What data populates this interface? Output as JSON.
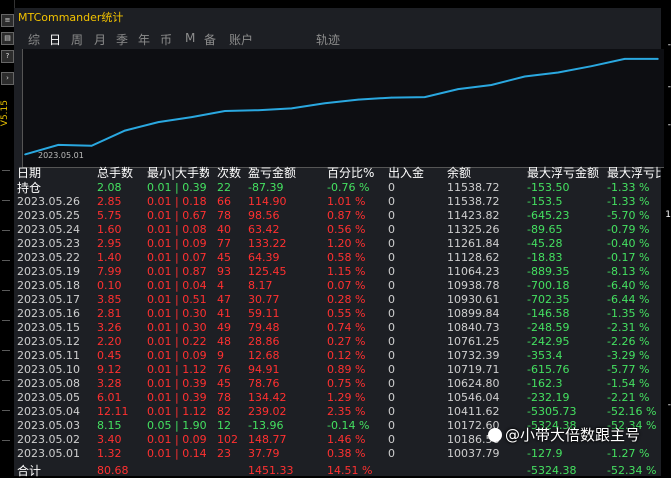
{
  "window": {
    "title": "MTCommander统计"
  },
  "sidebar": {
    "version": "V5.15"
  },
  "tabs": [
    {
      "label": "综",
      "active": false
    },
    {
      "label": "日",
      "active": true
    },
    {
      "label": "周",
      "active": false
    },
    {
      "label": "月",
      "active": false
    },
    {
      "label": "季",
      "active": false
    },
    {
      "label": "年",
      "active": false
    },
    {
      "label": "币",
      "active": false
    },
    {
      "label": "M",
      "active": false
    },
    {
      "label": "备",
      "active": false
    },
    {
      "label": "账户",
      "active": false
    },
    {
      "label": "轨迹",
      "active": false
    }
  ],
  "chart": {
    "x_label": "2023.05.01",
    "line_color": "#2aa8e0"
  },
  "chart_data": {
    "type": "line",
    "x": [
      "2023.05.01",
      "2023.05.02",
      "2023.05.03",
      "2023.05.04",
      "2023.05.05",
      "2023.05.08",
      "2023.05.09",
      "2023.05.10",
      "2023.05.11",
      "2023.05.12",
      "2023.05.15",
      "2023.05.16",
      "2023.05.17",
      "2023.05.18",
      "2023.05.19",
      "2023.05.22",
      "2023.05.23",
      "2023.05.24",
      "2023.05.25",
      "2023.05.26"
    ],
    "series": [
      {
        "values": [
          10037.79,
          10186.56,
          10172.6,
          10411.62,
          10546.04,
          10624.8,
          10719.71,
          10732.39,
          10761.25,
          10840.73,
          10899.84,
          10930.61,
          10938.78,
          11064.23,
          11128.62,
          11261.84,
          11325.26,
          11423.82,
          11538.72,
          11538.72
        ]
      }
    ],
    "ylim": [
      9950,
      11600
    ]
  },
  "table": {
    "headers": {
      "date": "日期",
      "total": "总手数",
      "lot": "最小|大手数",
      "count": "次数",
      "pl": "盈亏金额",
      "pct": "百分比%",
      "deposit": "出入金",
      "balance": "余额",
      "max_float_amt": "最大浮亏金额",
      "max_float_pct": "最大浮亏比"
    },
    "position": {
      "date": "持仓",
      "total": "2.08",
      "lot": "0.01 | 0.39",
      "count": "22",
      "pl": "-87.39",
      "pct": "-0.76 %",
      "deposit": "0",
      "balance": "11538.72",
      "max_float_amt": "-153.50",
      "max_float_pct": "-1.33 %"
    },
    "rows": [
      {
        "date": "2023.05.26",
        "total": "2.85",
        "lot": "0.01 | 0.18",
        "count": "66",
        "pl": "114.90",
        "pct": "1.01 %",
        "deposit": "0",
        "balance": "11538.72",
        "max_float_amt": "-153.5",
        "max_float_pct": "-1.33 %"
      },
      {
        "date": "2023.05.25",
        "total": "5.75",
        "lot": "0.01 | 0.67",
        "count": "78",
        "pl": "98.56",
        "pct": "0.87 %",
        "deposit": "0",
        "balance": "11423.82",
        "max_float_amt": "-645.23",
        "max_float_pct": "-5.70 %"
      },
      {
        "date": "2023.05.24",
        "total": "1.60",
        "lot": "0.01 | 0.08",
        "count": "40",
        "pl": "63.42",
        "pct": "0.56 %",
        "deposit": "0",
        "balance": "11325.26",
        "max_float_amt": "-89.65",
        "max_float_pct": "-0.79 %"
      },
      {
        "date": "2023.05.23",
        "total": "2.95",
        "lot": "0.01 | 0.09",
        "count": "77",
        "pl": "133.22",
        "pct": "1.20 %",
        "deposit": "0",
        "balance": "11261.84",
        "max_float_amt": "-45.28",
        "max_float_pct": "-0.40 %"
      },
      {
        "date": "2023.05.22",
        "total": "1.40",
        "lot": "0.01 | 0.07",
        "count": "45",
        "pl": "64.39",
        "pct": "0.58 %",
        "deposit": "0",
        "balance": "11128.62",
        "max_float_amt": "-18.83",
        "max_float_pct": "-0.17 %"
      },
      {
        "date": "2023.05.19",
        "total": "7.99",
        "lot": "0.01 | 0.87",
        "count": "93",
        "pl": "125.45",
        "pct": "1.15 %",
        "deposit": "0",
        "balance": "11064.23",
        "max_float_amt": "-889.35",
        "max_float_pct": "-8.13 %"
      },
      {
        "date": "2023.05.18",
        "total": "0.10",
        "lot": "0.01 | 0.04",
        "count": "4",
        "pl": "8.17",
        "pct": "0.07 %",
        "deposit": "0",
        "balance": "10938.78",
        "max_float_amt": "-700.18",
        "max_float_pct": "-6.40 %"
      },
      {
        "date": "2023.05.17",
        "total": "3.85",
        "lot": "0.01 | 0.51",
        "count": "47",
        "pl": "30.77",
        "pct": "0.28 %",
        "deposit": "0",
        "balance": "10930.61",
        "max_float_amt": "-702.35",
        "max_float_pct": "-6.44 %"
      },
      {
        "date": "2023.05.16",
        "total": "2.81",
        "lot": "0.01 | 0.30",
        "count": "41",
        "pl": "59.11",
        "pct": "0.55 %",
        "deposit": "0",
        "balance": "10899.84",
        "max_float_amt": "-146.58",
        "max_float_pct": "-1.35 %"
      },
      {
        "date": "2023.05.15",
        "total": "3.26",
        "lot": "0.01 | 0.30",
        "count": "49",
        "pl": "79.48",
        "pct": "0.74 %",
        "deposit": "0",
        "balance": "10840.73",
        "max_float_amt": "-248.59",
        "max_float_pct": "-2.31 %"
      },
      {
        "date": "2023.05.12",
        "total": "2.20",
        "lot": "0.01 | 0.22",
        "count": "48",
        "pl": "28.86",
        "pct": "0.27 %",
        "deposit": "0",
        "balance": "10761.25",
        "max_float_amt": "-242.95",
        "max_float_pct": "-2.26 %"
      },
      {
        "date": "2023.05.11",
        "total": "0.45",
        "lot": "0.01 | 0.09",
        "count": "9",
        "pl": "12.68",
        "pct": "0.12 %",
        "deposit": "0",
        "balance": "10732.39",
        "max_float_amt": "-353.4",
        "max_float_pct": "-3.29 %"
      },
      {
        "date": "2023.05.10",
        "total": "9.12",
        "lot": "0.01 | 1.12",
        "count": "76",
        "pl": "94.91",
        "pct": "0.89 %",
        "deposit": "0",
        "balance": "10719.71",
        "max_float_amt": "-615.76",
        "max_float_pct": "-5.77 %"
      },
      {
        "date": "2023.05.08",
        "total": "3.28",
        "lot": "0.01 | 0.39",
        "count": "45",
        "pl": "78.76",
        "pct": "0.75 %",
        "deposit": "0",
        "balance": "10624.80",
        "max_float_amt": "-162.3",
        "max_float_pct": "-1.54 %"
      },
      {
        "date": "2023.05.05",
        "total": "6.01",
        "lot": "0.01 | 0.39",
        "count": "78",
        "pl": "134.42",
        "pct": "1.29 %",
        "deposit": "0",
        "balance": "10546.04",
        "max_float_amt": "-232.19",
        "max_float_pct": "-2.21 %"
      },
      {
        "date": "2023.05.04",
        "total": "12.11",
        "lot": "0.01 | 1.12",
        "count": "82",
        "pl": "239.02",
        "pct": "2.35 %",
        "deposit": "0",
        "balance": "10411.62",
        "max_float_amt": "-5305.73",
        "max_float_pct": "-52.16 %"
      },
      {
        "date": "2023.05.03",
        "total": "8.15",
        "lot": "0.05 | 1.90",
        "count": "12",
        "pl": "-13.96",
        "pct": "-0.14 %",
        "deposit": "0",
        "balance": "10172.60",
        "max_float_amt": "-5324.38",
        "max_float_pct": "-52.34 %"
      },
      {
        "date": "2023.05.02",
        "total": "3.40",
        "lot": "0.01 | 0.09",
        "count": "102",
        "pl": "148.77",
        "pct": "1.46 %",
        "deposit": "0",
        "balance": "10186.56",
        "max_float_amt": "",
        "max_float_pct": ""
      },
      {
        "date": "2023.05.01",
        "total": "1.32",
        "pl_sign": "",
        "lot": "0.01 | 0.14",
        "count": "23",
        "pl": "37.79",
        "pct": "0.38 %",
        "deposit": "0",
        "balance": "10037.79",
        "max_float_amt": "-127.9",
        "max_float_pct": "-1.27 %"
      }
    ],
    "summary": {
      "date": "合计",
      "total": "80.68",
      "pl": "1451.33",
      "pct": "14.51 %",
      "max_float_amt": "-5324.38",
      "max_float_pct": "-52.34 %"
    }
  },
  "watermark": {
    "text": "@小带大倍数跟主号"
  },
  "colors": {
    "positive": "#ff3030",
    "negative": "#44e060",
    "title": "#f2c200",
    "panel_bg": "#1d1f24"
  }
}
